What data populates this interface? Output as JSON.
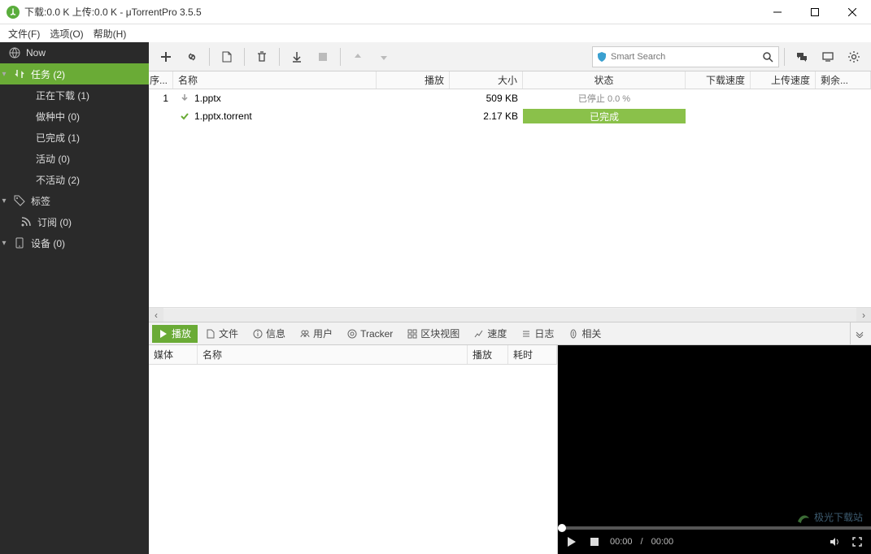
{
  "title": "下载:0.0 K 上传:0.0 K - μTorrentPro 3.5.5",
  "menu": {
    "file": "文件(F)",
    "options": "选项(O)",
    "help": "帮助(H)"
  },
  "sidebar": {
    "now": "Now",
    "tasks": "任务 (2)",
    "downloading": "正在下载 (1)",
    "seeding": "做种中 (0)",
    "completed": "已完成 (1)",
    "active": "活动 (0)",
    "inactive": "不活动 (2)",
    "labels": "标签",
    "feeds": "订阅 (0)",
    "devices": "设备 (0)"
  },
  "search": {
    "placeholder": "Smart Search"
  },
  "columns": {
    "seq": "序...",
    "name": "名称",
    "play": "播放",
    "size": "大小",
    "status": "状态",
    "dl": "下载速度",
    "ul": "上传速度",
    "rest": "剩余..."
  },
  "rows": [
    {
      "seq": "1",
      "name": "1.pptx",
      "size": "509 KB",
      "status": "已停止 0.0 %",
      "statusKind": "stopped"
    },
    {
      "seq": "",
      "name": "1.pptx.torrent",
      "size": "2.17 KB",
      "status": "已完成",
      "statusKind": "done"
    }
  ],
  "tabs": {
    "play": "播放",
    "files": "文件",
    "info": "信息",
    "peers": "用户",
    "trackers": "Tracker",
    "pieces": "区块视图",
    "speed": "速度",
    "log": "日志",
    "related": "相关"
  },
  "mediaCols": {
    "media": "媒体",
    "name": "名称",
    "play": "播放",
    "duration": "耗时"
  },
  "player": {
    "pos": "00:00",
    "dur": "00:00",
    "watermark": "极光下载站"
  }
}
